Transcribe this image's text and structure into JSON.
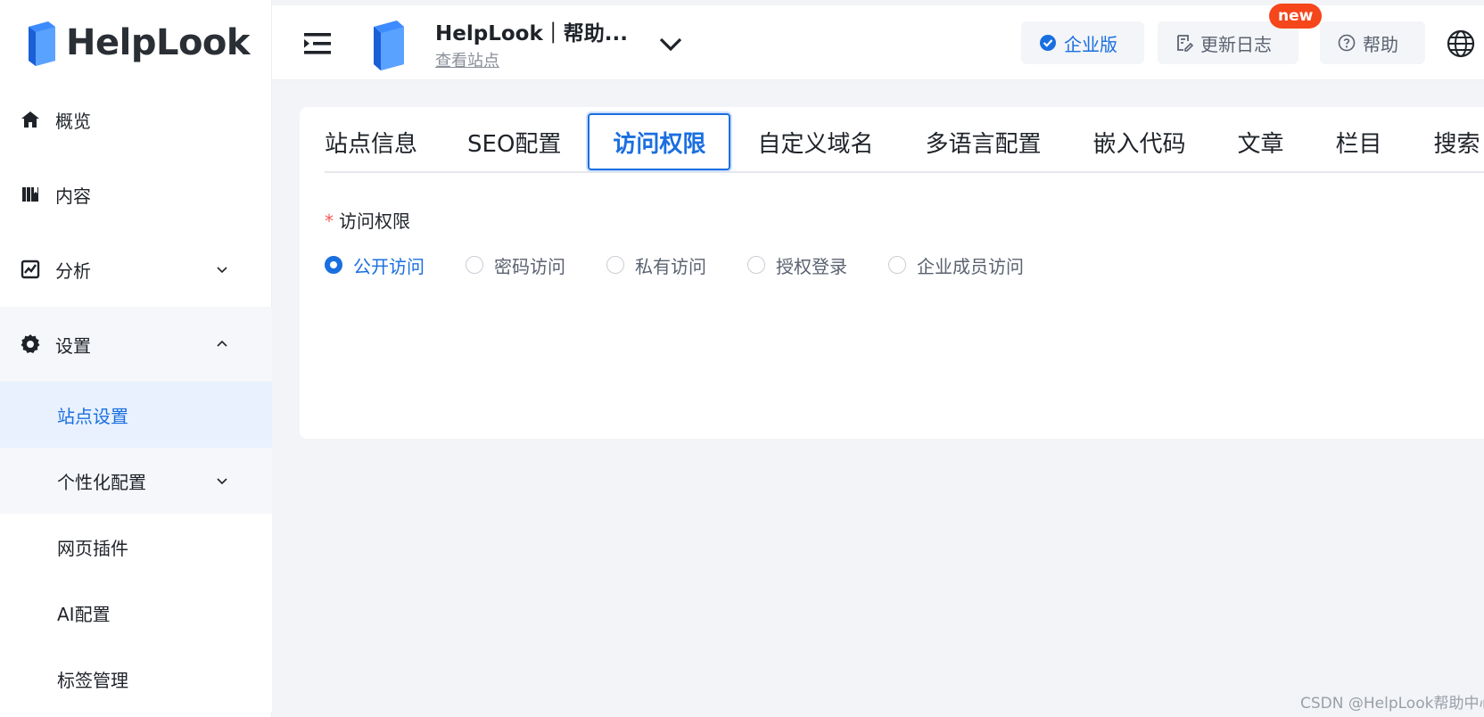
{
  "brand": {
    "name": "HelpLook",
    "color": "#1a6fe0"
  },
  "header": {
    "site_title": "HelpLook｜帮助...",
    "site_link": "查看站点",
    "enterprise_label": "企业版",
    "changelog_label": "更新日志",
    "changelog_badge": "new",
    "help_label": "帮助"
  },
  "sidebar": {
    "items": [
      {
        "label": "概览",
        "icon": "home-icon"
      },
      {
        "label": "内容",
        "icon": "book-icon"
      },
      {
        "label": "分析",
        "icon": "chart-icon",
        "expandable": true
      },
      {
        "label": "设置",
        "icon": "gear-icon",
        "expanded": true
      }
    ],
    "sub_items": [
      {
        "label": "站点设置",
        "active": true
      },
      {
        "label": "个性化配置",
        "expandable": true
      },
      {
        "label": "网页插件"
      },
      {
        "label": "AI配置"
      },
      {
        "label": "标签管理"
      }
    ]
  },
  "tabs": [
    {
      "label": "站点信息"
    },
    {
      "label": "SEO配置"
    },
    {
      "label": "访问权限",
      "active": true
    },
    {
      "label": "自定义域名"
    },
    {
      "label": "多语言配置"
    },
    {
      "label": "嵌入代码"
    },
    {
      "label": "文章"
    },
    {
      "label": "栏目"
    },
    {
      "label": "搜索"
    }
  ],
  "form": {
    "required_mark": "*",
    "label": "访问权限",
    "options": [
      {
        "label": "公开访问",
        "checked": true
      },
      {
        "label": "密码访问"
      },
      {
        "label": "私有访问"
      },
      {
        "label": "授权登录"
      },
      {
        "label": "企业成员访问"
      }
    ]
  },
  "watermark": "CSDN @HelpLook帮助中心"
}
